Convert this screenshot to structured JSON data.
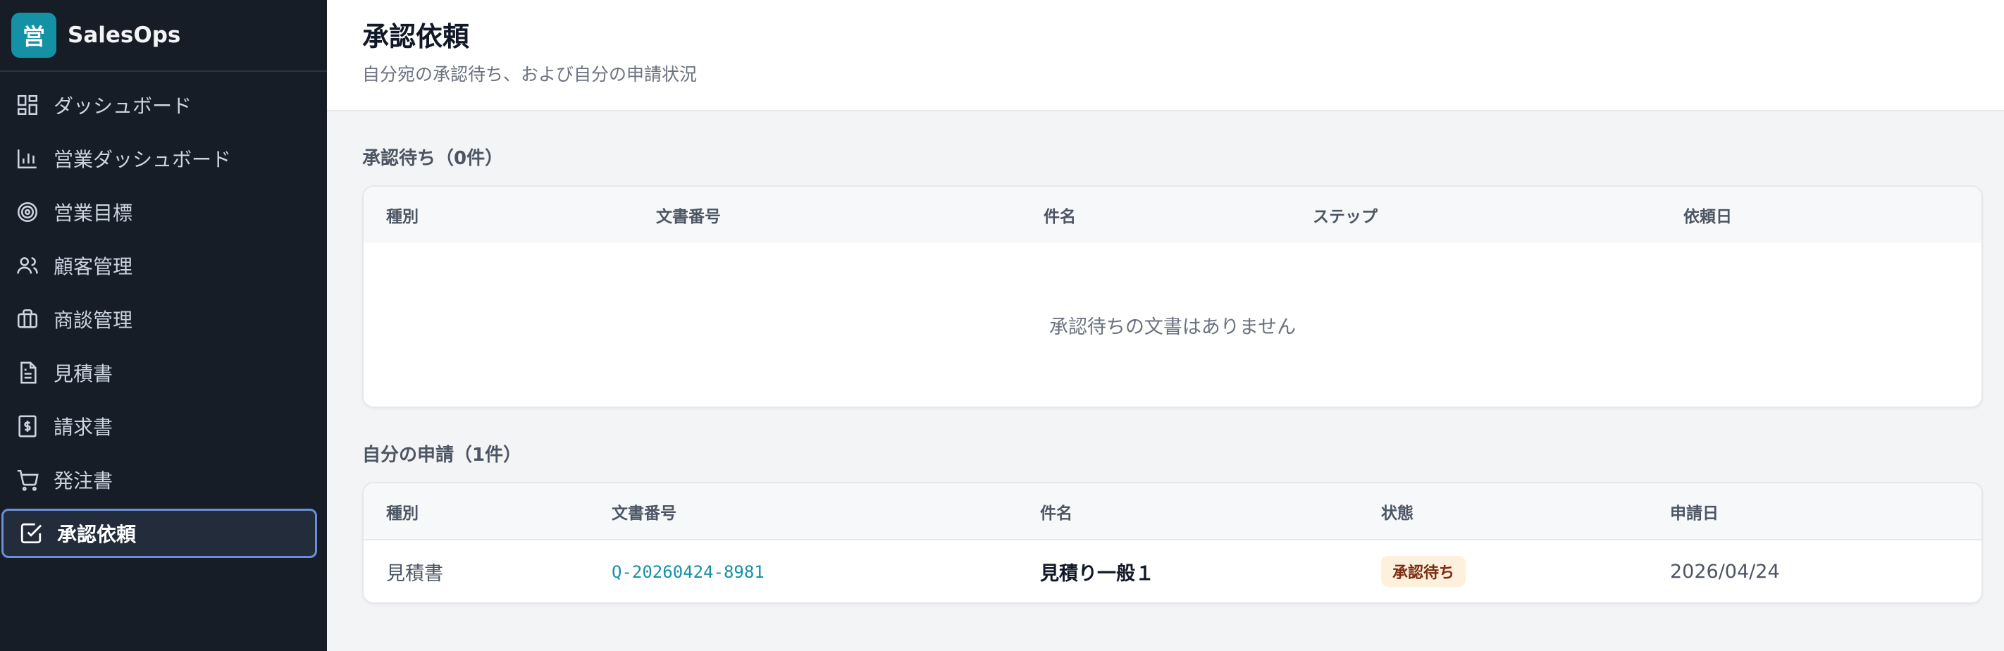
{
  "brand": {
    "logo_char": "営",
    "name": "SalesOps",
    "logo_color": "#1591a5"
  },
  "sidebar": {
    "items": [
      {
        "label": "ダッシュボード",
        "icon": "dashboard-icon"
      },
      {
        "label": "営業ダッシュボード",
        "icon": "bar-chart-icon"
      },
      {
        "label": "営業目標",
        "icon": "target-icon"
      },
      {
        "label": "顧客管理",
        "icon": "users-icon"
      },
      {
        "label": "商談管理",
        "icon": "briefcase-icon"
      },
      {
        "label": "見積書",
        "icon": "document-icon"
      },
      {
        "label": "請求書",
        "icon": "invoice-icon"
      },
      {
        "label": "発注書",
        "icon": "cart-icon"
      },
      {
        "label": "承認依頼",
        "icon": "check-square-icon",
        "active": true
      }
    ]
  },
  "header": {
    "title": "承認依頼",
    "subtitle": "自分宛の承認待ち、および自分の申請状況"
  },
  "pending": {
    "title": "承認待ち（0件）",
    "columns": [
      "種別",
      "文書番号",
      "件名",
      "ステップ",
      "依頼日"
    ],
    "empty_message": "承認待ちの文書はありません"
  },
  "mine": {
    "title": "自分の申請（1件）",
    "columns": [
      "種別",
      "文書番号",
      "件名",
      "状態",
      "申請日"
    ],
    "rows": [
      {
        "type": "見積書",
        "doc_no": "Q-20260424-8981",
        "subject": "見積り一般１",
        "status": "承認待ち",
        "date": "2026/04/24"
      }
    ]
  }
}
